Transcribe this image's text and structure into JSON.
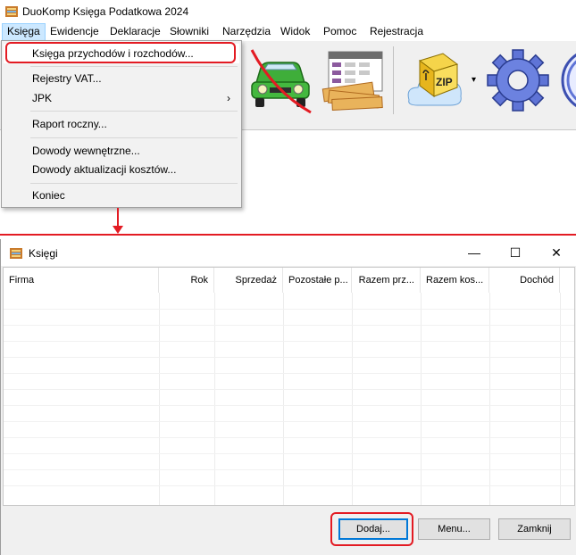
{
  "app": {
    "title": "DuoKomp Księga Podatkowa 2024",
    "icon": "ledger-app-icon"
  },
  "menubar": [
    "Księga",
    "Ewidencje",
    "Deklaracje",
    "Słowniki",
    "Narzędzia",
    "Widok",
    "Pomoc",
    "Rejestracja"
  ],
  "toolbar": {
    "buttons": [
      "car-no-entry-icon",
      "money-table-icon",
      "zip-archive-icon",
      "gear-icon",
      "globe-icon"
    ],
    "dropdown_arrow": "▾"
  },
  "dropdown": {
    "items": [
      "Księga przychodów i rozchodów...",
      "Rejestry VAT...",
      "JPK",
      "Raport roczny...",
      "Dowody wewnętrzne...",
      "Dowody aktualizacji kosztów...",
      "Koniec"
    ],
    "submenu_arrow": "›"
  },
  "ksiegi_window": {
    "title": "Księgi",
    "controls": {
      "minimize": "—",
      "maximize": "☐",
      "close": "✕"
    },
    "columns": [
      "Firma",
      "Rok",
      "Sprzedaż",
      "Pozostałe p...",
      "Razem prz...",
      "Razem kos...",
      "Dochód"
    ],
    "buttons": {
      "add": "Dodaj...",
      "menu": "Menu...",
      "close": "Zamknij"
    }
  },
  "colors": {
    "highlight": "#e31b23",
    "menu_active": "#cce8ff",
    "default_button": "#0078d7"
  }
}
